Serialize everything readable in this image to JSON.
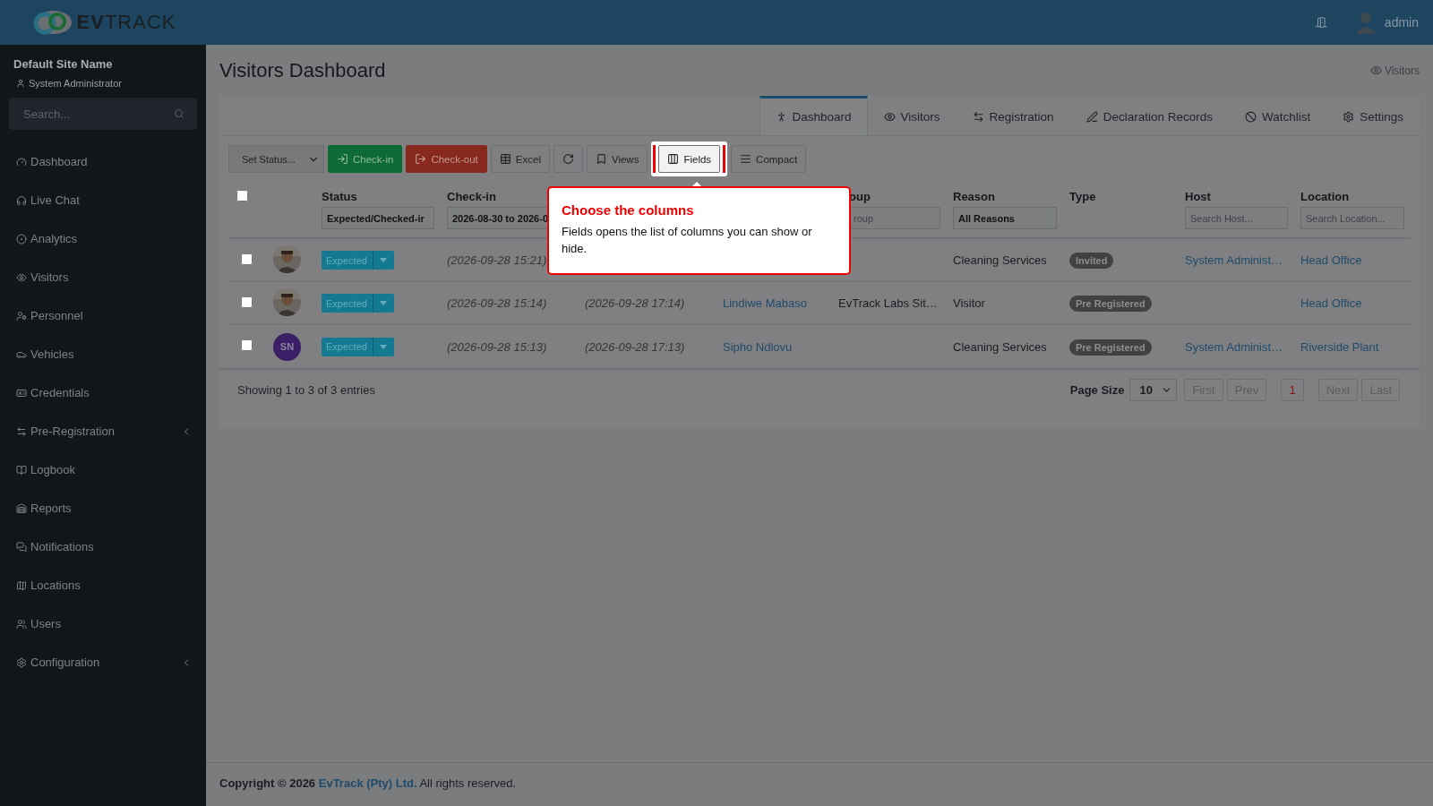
{
  "header": {
    "logo": "**EV**TRACK",
    "user": "admin"
  },
  "sidebar": {
    "site_name": "Default Site Name",
    "role": "System Administrator",
    "search_placeholder": "Search...",
    "items": [
      {
        "label": "Dashboard",
        "expandable": false
      },
      {
        "label": "Live Chat",
        "expandable": false
      },
      {
        "label": "Analytics",
        "expandable": false
      },
      {
        "label": "Visitors",
        "expandable": false
      },
      {
        "label": "Personnel",
        "expandable": false
      },
      {
        "label": "Vehicles",
        "expandable": false
      },
      {
        "label": "Credentials",
        "expandable": false
      },
      {
        "label": "Pre-Registration",
        "expandable": true
      },
      {
        "label": "Logbook",
        "expandable": false
      },
      {
        "label": "Reports",
        "expandable": false
      },
      {
        "label": "Notifications",
        "expandable": false
      },
      {
        "label": "Locations",
        "expandable": false
      },
      {
        "label": "Users",
        "expandable": false
      },
      {
        "label": "Configuration",
        "expandable": true
      }
    ]
  },
  "page": {
    "title": "Visitors Dashboard",
    "breadcrumb": "Visitors"
  },
  "tabs": [
    {
      "label": "Dashboard",
      "selected": true
    },
    {
      "label": "Visitors",
      "selected": false
    },
    {
      "label": "Registration",
      "selected": false
    },
    {
      "label": "Declaration Records",
      "selected": false
    },
    {
      "label": "Watchlist",
      "selected": false
    },
    {
      "label": "Settings",
      "selected": false
    }
  ],
  "toolbar": {
    "status_select": "Set Status...",
    "buttons": [
      {
        "kind": "checkin",
        "label": "Check-in",
        "highlighted": false
      },
      {
        "kind": "checkout",
        "label": "Check-out",
        "highlighted": false
      },
      {
        "kind": "excel",
        "label": "Excel",
        "highlighted": false
      },
      {
        "kind": "refresh",
        "highlighted": false
      },
      {
        "kind": "views",
        "label": "Views",
        "highlighted": false
      },
      {
        "kind": "fields",
        "label": "Fields",
        "highlighted": true
      },
      {
        "kind": "compact",
        "label": "Compact",
        "highlighted": false
      }
    ]
  },
  "table": {
    "columns": [
      {
        "kind": "checkbox",
        "checked": false
      },
      {
        "kind": "blank"
      },
      {
        "kind": "header",
        "header": "Status",
        "filter": {
          "kind": "select",
          "value": "Expected/Checked-ir"
        }
      },
      {
        "kind": "header",
        "header": "Check-in",
        "filter": {
          "kind": "value",
          "value": "2026-08-30 to 2026-0"
        }
      },
      {
        "kind": "blank"
      },
      {
        "kind": "blank"
      },
      {
        "kind": "header",
        "header": "oup",
        "filter": {
          "kind": "text",
          "placeholder": "roup"
        }
      },
      {
        "kind": "header",
        "header": "Reason",
        "filter": {
          "kind": "select",
          "value": "All Reasons"
        }
      },
      {
        "kind": "header",
        "header": "Type"
      },
      {
        "kind": "header",
        "header": "Host",
        "filter": {
          "kind": "text",
          "placeholder": "Search Host..."
        }
      },
      {
        "kind": "header",
        "header": "Location",
        "filter": {
          "kind": "text",
          "placeholder": "Search Location..."
        }
      }
    ],
    "rows": [
      {
        "selected": false,
        "cells": [
          {
            "kind": "checkbox"
          },
          {
            "kind": "picture"
          },
          {
            "kind": "status",
            "text": "Expected"
          },
          {
            "kind": "date",
            "text": "(2026-09-28 15:21)"
          },
          {
            "kind": "empty"
          },
          {
            "kind": "empty"
          },
          {
            "kind": "empty"
          },
          {
            "kind": "text",
            "text": "Cleaning Services"
          },
          {
            "kind": "badge",
            "text": "Invited"
          },
          {
            "kind": "link",
            "text": "System Administ…"
          },
          {
            "kind": "link",
            "text": "Head Office"
          }
        ]
      },
      {
        "selected": false,
        "cells": [
          {
            "kind": "checkbox"
          },
          {
            "kind": "picture"
          },
          {
            "kind": "status",
            "text": "Expected"
          },
          {
            "kind": "date",
            "text": "(2026-09-28 15:14)"
          },
          {
            "kind": "date",
            "text": "(2026-09-28 17:14)"
          },
          {
            "kind": "link",
            "text": "Lindiwe Mabaso"
          },
          {
            "kind": "text",
            "text": "EvTrack Labs Sit…"
          },
          {
            "kind": "text",
            "text": "Visitor"
          },
          {
            "kind": "badge",
            "text": "Pre Registered"
          },
          {
            "kind": "empty"
          },
          {
            "kind": "link",
            "text": "Head Office"
          }
        ]
      },
      {
        "selected": false,
        "cells": [
          {
            "kind": "checkbox"
          },
          {
            "kind": "initials",
            "text": "SN",
            "color": "#3a1f66"
          },
          {
            "kind": "status",
            "text": "Expected"
          },
          {
            "kind": "date",
            "text": "(2026-09-28 15:13)"
          },
          {
            "kind": "date",
            "text": "(2026-09-28 17:13)"
          },
          {
            "kind": "link",
            "text": "Sipho Ndlovu"
          },
          {
            "kind": "empty"
          },
          {
            "kind": "text",
            "text": "Cleaning Services"
          },
          {
            "kind": "badge",
            "text": "Pre Registered"
          },
          {
            "kind": "link",
            "text": "System Administ…"
          },
          {
            "kind": "link",
            "text": "Riverside Plant"
          }
        ]
      }
    ]
  },
  "pagination": {
    "summary": "Showing 1 to 3 of 3 entries",
    "page_size_label": "Page Size",
    "page_size": "10",
    "pages": [
      {
        "label": "First",
        "selected": false,
        "disabled": true
      },
      {
        "label": "Prev",
        "selected": false,
        "disabled": true
      },
      {
        "label": "1",
        "selected": true,
        "disabled": false
      },
      {
        "label": "Next",
        "selected": false,
        "disabled": true
      },
      {
        "label": "Last",
        "selected": false,
        "disabled": true
      }
    ]
  },
  "tour": {
    "title": "Choose the columns",
    "text": "Fields opens the list of columns you can show or hide."
  },
  "footer": {
    "prefix": "Copyright © 2026",
    "link": "EvTrack (Pty) Ltd.",
    "suffix": "All rights reserved."
  }
}
